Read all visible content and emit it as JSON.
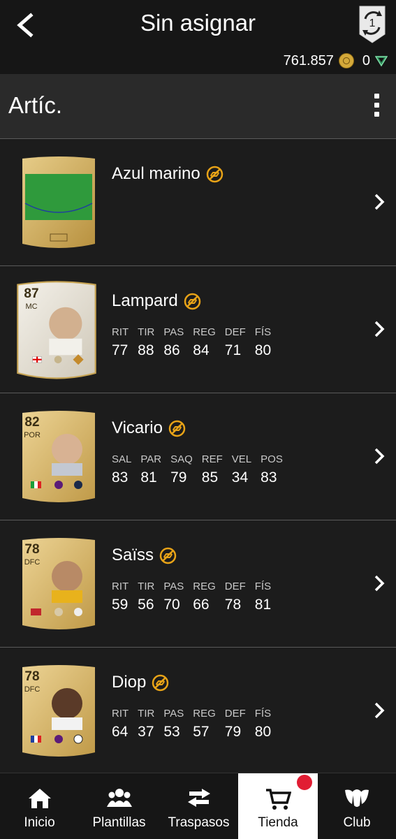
{
  "header": {
    "title": "Sin asignar",
    "coins": "761.857",
    "points": "0",
    "sync_badge": "1"
  },
  "section": {
    "title": "Artíc."
  },
  "items": [
    {
      "name": "Azul marino",
      "type": "pitch"
    },
    {
      "name": "Lampard",
      "rating": "87",
      "position": "MC",
      "stats": [
        {
          "label": "RIT",
          "value": "77"
        },
        {
          "label": "TIR",
          "value": "88"
        },
        {
          "label": "PAS",
          "value": "86"
        },
        {
          "label": "REG",
          "value": "84"
        },
        {
          "label": "DEF",
          "value": "71"
        },
        {
          "label": "FÍS",
          "value": "80"
        }
      ]
    },
    {
      "name": "Vicario",
      "rating": "82",
      "position": "POR",
      "stats": [
        {
          "label": "SAL",
          "value": "83"
        },
        {
          "label": "PAR",
          "value": "81"
        },
        {
          "label": "SAQ",
          "value": "79"
        },
        {
          "label": "REF",
          "value": "85"
        },
        {
          "label": "VEL",
          "value": "34"
        },
        {
          "label": "POS",
          "value": "83"
        }
      ]
    },
    {
      "name": "Saïss",
      "rating": "78",
      "position": "DFC",
      "stats": [
        {
          "label": "RIT",
          "value": "59"
        },
        {
          "label": "TIR",
          "value": "56"
        },
        {
          "label": "PAS",
          "value": "70"
        },
        {
          "label": "REG",
          "value": "66"
        },
        {
          "label": "DEF",
          "value": "78"
        },
        {
          "label": "FÍS",
          "value": "81"
        }
      ]
    },
    {
      "name": "Diop",
      "rating": "78",
      "position": "DFC",
      "stats": [
        {
          "label": "RIT",
          "value": "64"
        },
        {
          "label": "TIR",
          "value": "37"
        },
        {
          "label": "PAS",
          "value": "53"
        },
        {
          "label": "REG",
          "value": "57"
        },
        {
          "label": "DEF",
          "value": "79"
        },
        {
          "label": "FÍS",
          "value": "80"
        }
      ]
    }
  ],
  "nav": [
    {
      "label": "Inicio",
      "icon": "home-icon"
    },
    {
      "label": "Plantillas",
      "icon": "squad-icon"
    },
    {
      "label": "Traspasos",
      "icon": "transfer-icon"
    },
    {
      "label": "Tienda",
      "icon": "cart-icon",
      "active": true
    },
    {
      "label": "Club",
      "icon": "club-icon"
    }
  ],
  "colors": {
    "untradeable": "#e8a317",
    "active_nav_bg": "#ffffff",
    "badge": "#e11d33"
  }
}
